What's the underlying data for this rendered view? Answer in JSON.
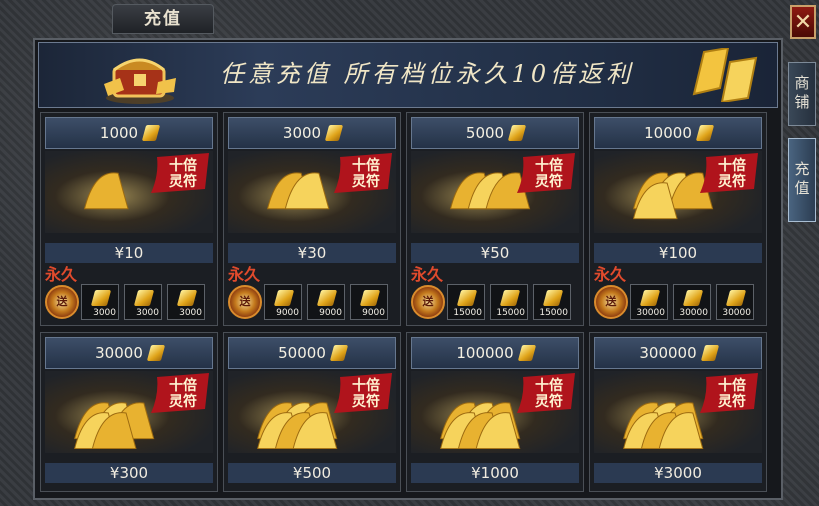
{
  "window": {
    "title": "充值",
    "close_label": "✕"
  },
  "side_tabs": [
    {
      "label": "商铺",
      "active": false
    },
    {
      "label": "充值",
      "active": true
    }
  ],
  "banner": {
    "text": "任意充值 所有档位永久10倍返利"
  },
  "badge": {
    "line1": "十倍",
    "line2": "灵符"
  },
  "permanent_label": "永久",
  "bonus_label": "送",
  "tiers": [
    {
      "amount": "1000",
      "price": "¥10",
      "rewards": [
        "3000",
        "3000",
        "3000"
      ]
    },
    {
      "amount": "3000",
      "price": "¥30",
      "rewards": [
        "9000",
        "9000",
        "9000"
      ]
    },
    {
      "amount": "5000",
      "price": "¥50",
      "rewards": [
        "15000",
        "15000",
        "15000"
      ]
    },
    {
      "amount": "10000",
      "price": "¥100",
      "rewards": [
        "30000",
        "30000",
        "30000"
      ]
    },
    {
      "amount": "30000",
      "price": "¥300"
    },
    {
      "amount": "50000",
      "price": "¥500"
    },
    {
      "amount": "100000",
      "price": "¥1000"
    },
    {
      "amount": "300000",
      "price": "¥3000"
    }
  ],
  "colors": {
    "accent_gold": "#e0a41a",
    "permanent_red": "#e04a2c",
    "badge_red": "#b0141c"
  }
}
